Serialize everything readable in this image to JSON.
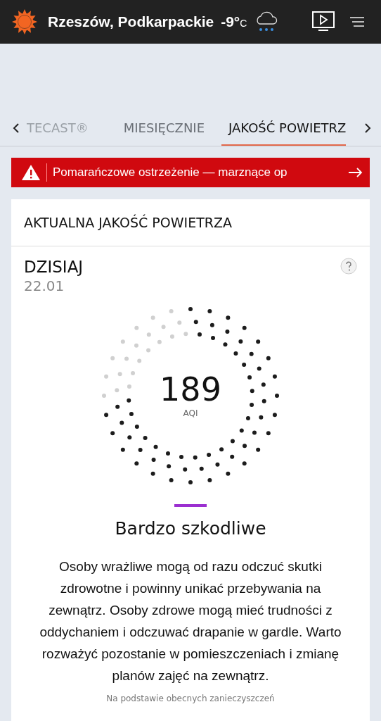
{
  "header": {
    "location": "Rzeszów, Podkarpackie",
    "temperature": "-9°",
    "unit": "C"
  },
  "tabs": [
    {
      "label": "TECAST®",
      "selected": false
    },
    {
      "label": "MIESIĘCZNIE",
      "selected": false
    },
    {
      "label": "JAKOŚĆ POWIETRZ",
      "selected": true
    }
  ],
  "alert": {
    "text": "Pomarańczowe ostrzeżenie — marznące op"
  },
  "card": {
    "title": "AKTUALNA JAKOŚĆ POWIETRZA",
    "day": "DZISIAJ",
    "date": "22.01",
    "gauge": {
      "value": "189",
      "unit": "AQI"
    },
    "category": {
      "label": "Bardzo szkodliwe",
      "color": "#9b2fd0"
    },
    "description": "Osoby wrażliwe mogą od razu odczuć skutki zdrowotne i powinny unikać przebywania na zewnątrz. Osoby zdrowe mogą mieć trudności z oddychaniem i odczuwać drapanie w gardle. Warto rozważyć pozostanie w pomieszczeniach i zmianę planów zajęć na zewnątrz.",
    "footnote": "Na podstawie obecnych zanieczyszczeń"
  }
}
